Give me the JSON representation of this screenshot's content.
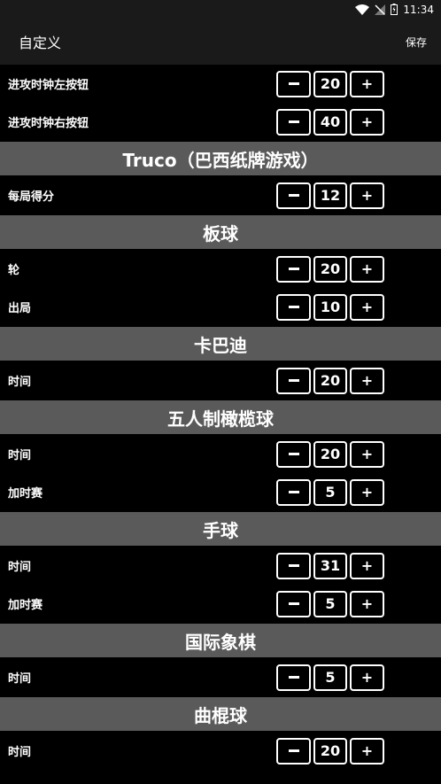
{
  "status": {
    "time": "11:34"
  },
  "header": {
    "title": "自定义",
    "save_label": "保存"
  },
  "buttons": {
    "minus": "–",
    "plus": "+"
  },
  "rows_top": [
    {
      "label": "进攻时钟左按钮",
      "value": "20"
    },
    {
      "label": "进攻时钟右按钮",
      "value": "40"
    }
  ],
  "sections": [
    {
      "title": "Truco（巴西纸牌游戏）",
      "rows": [
        {
          "label": "每局得分",
          "value": "12"
        }
      ]
    },
    {
      "title": "板球",
      "rows": [
        {
          "label": "轮",
          "value": "20"
        },
        {
          "label": "出局",
          "value": "10"
        }
      ]
    },
    {
      "title": "卡巴迪",
      "rows": [
        {
          "label": "时间",
          "value": "20"
        }
      ]
    },
    {
      "title": "五人制橄榄球",
      "rows": [
        {
          "label": "时间",
          "value": "20"
        },
        {
          "label": "加时赛",
          "value": "5"
        }
      ]
    },
    {
      "title": "手球",
      "rows": [
        {
          "label": "时间",
          "value": "31"
        },
        {
          "label": "加时赛",
          "value": "5"
        }
      ]
    },
    {
      "title": "国际象棋",
      "rows": [
        {
          "label": "时间",
          "value": "5"
        }
      ]
    },
    {
      "title": "曲棍球",
      "rows": [
        {
          "label": "时间",
          "value": "20"
        }
      ]
    }
  ]
}
